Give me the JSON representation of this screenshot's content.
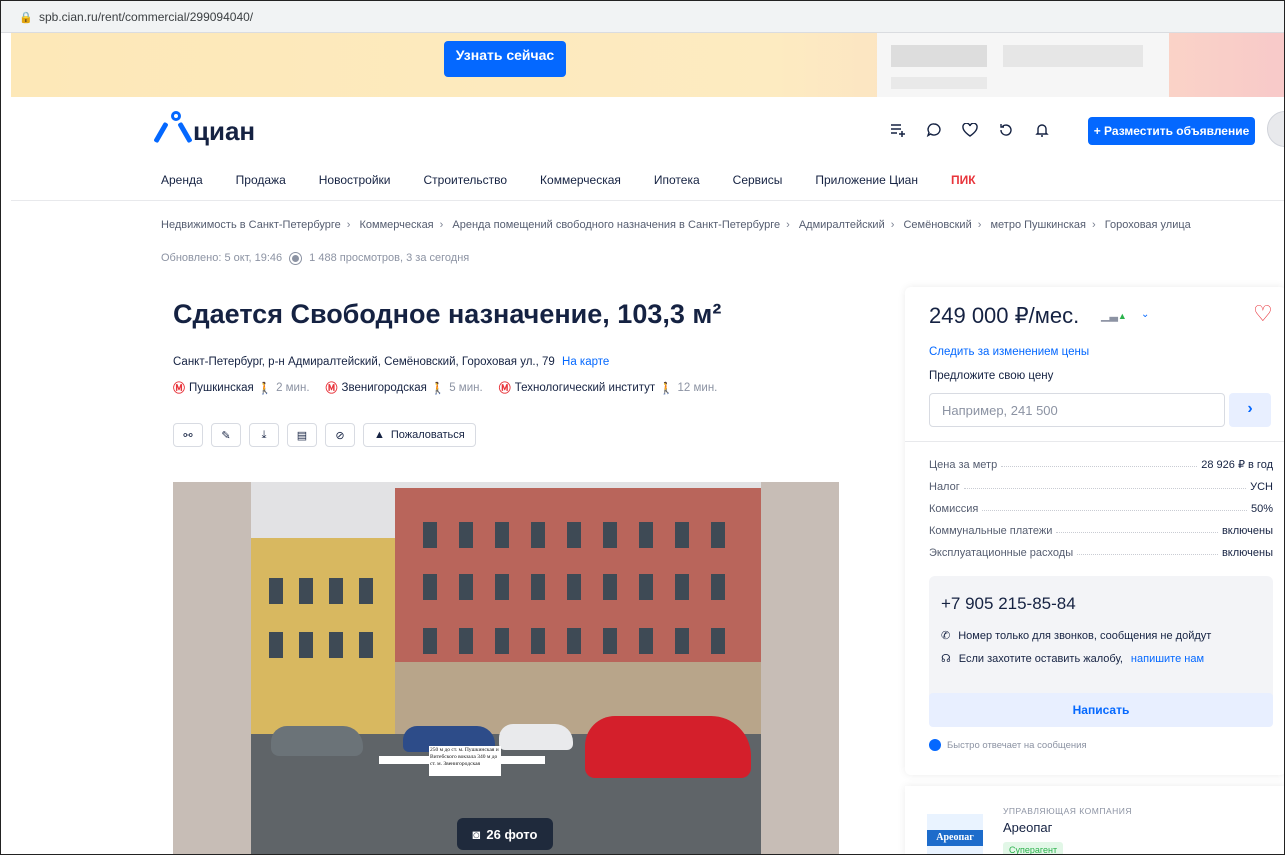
{
  "browser": {
    "url": "spb.cian.ru/rent/commercial/299094040/"
  },
  "banner": {
    "cta_label": "Узнать сейчас"
  },
  "header": {
    "logo_text": "циан",
    "post_button_label": "+ Разместить объявление",
    "icons": [
      "compare-icon",
      "chat-icon",
      "favorite-icon",
      "history-icon",
      "notifications-icon"
    ]
  },
  "nav": {
    "items": [
      "Аренда",
      "Продажа",
      "Новостройки",
      "Строительство",
      "Коммерческая",
      "Ипотека",
      "Сервисы",
      "Приложение Циан"
    ],
    "pik_label": "ПИК"
  },
  "breadcrumbs": [
    "Недвижимость в Санкт-Петербурге",
    "Коммерческая",
    "Аренда помещений свободного назначения в Санкт-Петербурге",
    "Адмиралтейский",
    "Семёновский",
    "метро Пушкинская",
    "Гороховая улица"
  ],
  "meta": {
    "updated": "Обновлено: 5 окт, 19:46",
    "views": "1 488 просмотров, 3 за сегодня"
  },
  "listing": {
    "title": "Сдается Свободное назначение, 103,3 м²",
    "address": "Санкт-Петербург, р-н Адмиралтейский, Семёновский, Гороховая ул., 79",
    "map_link": "На карте",
    "metros": [
      {
        "name": "Пушкинская",
        "walk": "2 мин."
      },
      {
        "name": "Звенигородская",
        "walk": "5 мин."
      },
      {
        "name": "Технологический институт",
        "walk": "12 мин."
      }
    ],
    "complain_label": "Пожаловаться",
    "photos_label": "26 фото",
    "photo_note": "250 м до ст. м. Пушкинская и Витебского вокзала 340 м до ст. м. Звенигородская"
  },
  "price_panel": {
    "price": "249 000 ₽/мес.",
    "watch_link": "Следить за изменением цены",
    "offer_label": "Предложите свою цену",
    "offer_placeholder": "Например, 241 500",
    "facts": [
      {
        "label": "Цена за метр",
        "value": "28 926 ₽ в год"
      },
      {
        "label": "Налог",
        "value": "УСН"
      },
      {
        "label": "Комиссия",
        "value": "50%"
      },
      {
        "label": "Коммунальные платежи",
        "value": "включены"
      },
      {
        "label": "Эксплуатационные расходы",
        "value": "включены"
      }
    ],
    "phone": "+7 905 215-85-84",
    "phone_note": "Номер только для звонков, сообщения не дойдут",
    "complaint_text": "Если захотите оставить жалобу,",
    "complaint_link": "напишите нам",
    "write_label": "Написать",
    "fast_reply": "Быстро отвечает на сообщения"
  },
  "agency": {
    "kind": "УПРАВЛЯЮЩАЯ КОМПАНИЯ",
    "name": "Ареопаг",
    "logo_text": "Ареопаг",
    "badge": "Суперагент"
  },
  "colors": {
    "accent": "#0468ff",
    "brand_red": "#e8343b",
    "text": "#152242"
  }
}
